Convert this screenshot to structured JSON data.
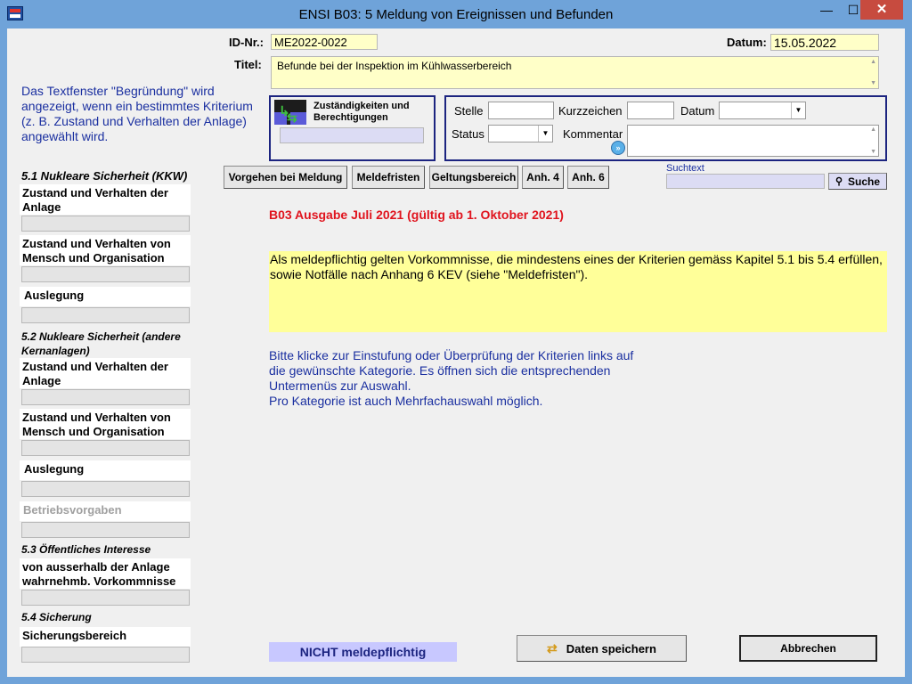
{
  "window": {
    "title": "ENSI B03:  5 Meldung von Ereignissen und Befunden",
    "minimize": "—",
    "maximize": "☐",
    "close": "✕"
  },
  "header": {
    "id_label": "ID-Nr.:",
    "id_value": "ME2022-0022",
    "date_label": "Datum:",
    "date_value": "15.05.2022",
    "title_label": "Titel:",
    "title_value": "Befunde bei der Inspektion im Kühlwasserbereich"
  },
  "info_text": "Das Textfenster \"Begründung\" wird angezeigt, wenn ein bestimmtes Kriterium (z. B. Zustand und Verhalten der Anlage) angewählt wird.",
  "responsibilities": {
    "label": "Zuständigkeiten und Berechtigungen"
  },
  "assignment": {
    "stelle_label": "Stelle",
    "kurzzeichen_label": "Kurzzeichen",
    "datum_label": "Datum",
    "status_label": "Status",
    "kommentar_label": "Kommentar"
  },
  "toolbar": {
    "buttons": [
      "Vorgehen bei Meldung",
      "Meldefristen",
      "Geltungsbereich",
      "Anh. 4",
      "Anh. 6"
    ],
    "search_label": "Suchtext",
    "search_button": "Suche"
  },
  "sidebar": {
    "sec1": "5.1 Nukleare Sicherheit (KKW)",
    "sec1_items": [
      "Zustand und Verhalten der Anlage",
      "Zustand und Verhalten von Mensch und Organisation",
      "Auslegung"
    ],
    "sec2": "5.2  Nukleare Sicherheit (andere Kernanlagen)",
    "sec2_items": [
      "Zustand und Verhalten der Anlage",
      "Zustand und Verhalten von Mensch und Organisation",
      "Auslegung",
      "Betriebsvorgaben"
    ],
    "sec3": "5.3  Öffentliches Interesse",
    "sec3_items": [
      "von ausserhalb der Anlage wahrnehmb. Vorkommnisse"
    ],
    "sec4": "5.4  Sicherung",
    "sec4_items": [
      "Sicherungsbereich"
    ]
  },
  "main": {
    "edition": "B03 Ausgabe Juli 2021 (gültig ab 1. Oktober 2021)",
    "notice": "Als meldepflichtig gelten Vorkommnisse, die mindestens eines der Kriterien gemäss Kapitel 5.1 bis 5.4 erfüllen, sowie Notfälle nach Anhang 6 KEV (siehe \"Meldefristen\").",
    "instructions": [
      "Bitte klicke zur Einstufung oder Überprüfung der Kriterien links auf",
      "die gewünschte Kategorie. Es öffnen sich die entsprechenden",
      "Untermenüs zur Auswahl.",
      "Pro Kategorie ist auch Mehrfachauswahl möglich."
    ]
  },
  "footer": {
    "status": "NICHT meldepflichtig",
    "save": "Daten speichern",
    "cancel": "Abbrechen"
  },
  "colors": {
    "titlebar": "#6fa3d9",
    "info_blue": "#1a2fa0",
    "edition_red": "#e0141e",
    "notice_yellow": "#ffff99",
    "status_bg": "#c8c8ff"
  }
}
